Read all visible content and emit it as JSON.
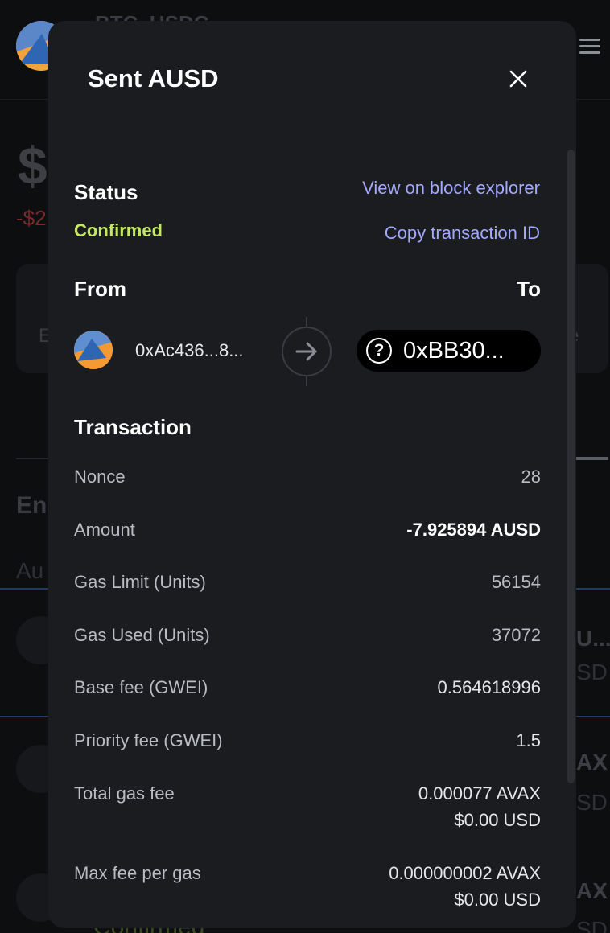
{
  "background": {
    "title": "BTC..USDC",
    "balance": "$",
    "change": "-$2",
    "card_left": "E",
    "card_right": "e",
    "section": "En",
    "sub": "Au",
    "row1_right": "U...",
    "row1_right_sub": "SD",
    "row2_right": "AX",
    "row2_right_sub": "SD",
    "row3_right": "AX",
    "row3_right_sub": "SD",
    "bottom_status": "Confirmed"
  },
  "modal": {
    "title": "Sent AUSD",
    "status_label": "Status",
    "status_value": "Confirmed",
    "view_explorer": "View on block explorer",
    "copy_tx": "Copy transaction ID",
    "from_label": "From",
    "to_label": "To",
    "from_address": "0xAc436...8...",
    "to_address": "0xBB30...",
    "transaction_label": "Transaction",
    "rows": [
      {
        "label": "Nonce",
        "value": "28"
      },
      {
        "label": "Amount",
        "value": "-7.925894 AUSD"
      },
      {
        "label": "Gas Limit (Units)",
        "value": "56154"
      },
      {
        "label": "Gas Used (Units)",
        "value": "37072"
      },
      {
        "label": "Base fee (GWEI)",
        "value": "0.564618996"
      },
      {
        "label": "Priority fee (GWEI)",
        "value": "1.5"
      },
      {
        "label": "Total gas fee",
        "value": "0.000077 AVAX",
        "value2": "$0.00 USD"
      },
      {
        "label": "Max fee per gas",
        "value": "0.000000002 AVAX",
        "value2": "$0.00 USD"
      }
    ]
  },
  "icons": {
    "close": "close-icon",
    "arrow": "arrow-right-icon",
    "unknown": "question-icon"
  },
  "colors": {
    "accent_link": "#a3a9ff",
    "status_green": "#c5e863",
    "modal_bg": "#1b1c20"
  }
}
